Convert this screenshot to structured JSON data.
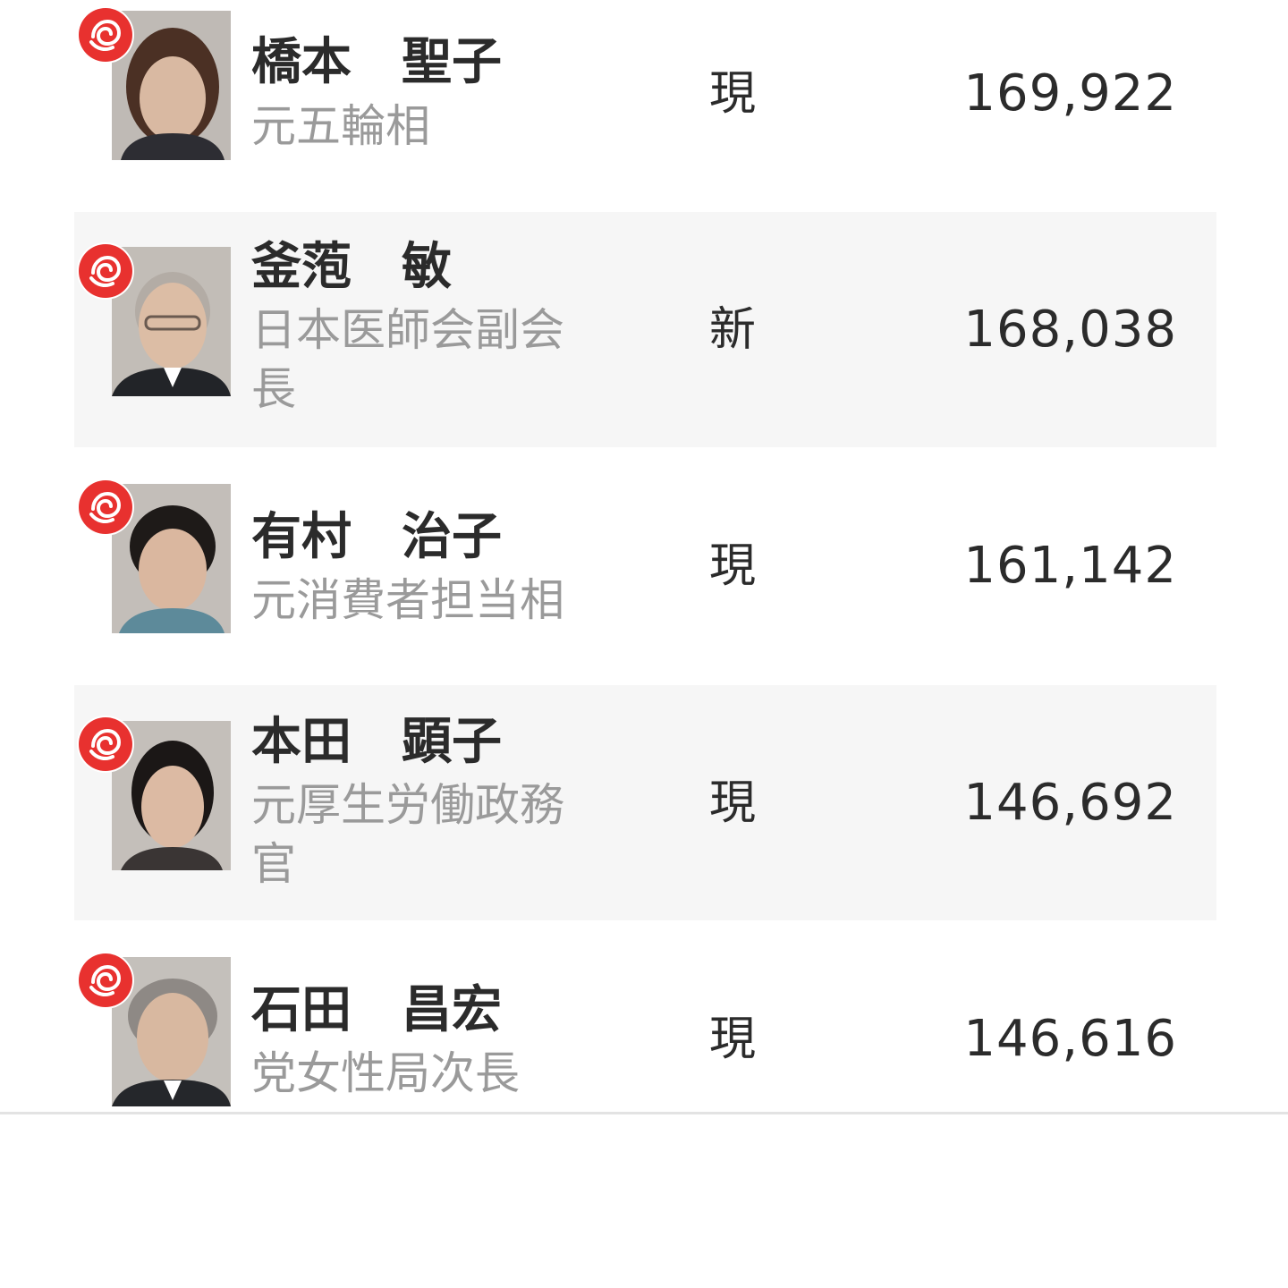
{
  "candidates": [
    {
      "name": "橋本　聖子",
      "title": "元五輪相",
      "status": "現",
      "votes": "169,922",
      "party_mark": "rose-icon",
      "party_color": "#e8312f"
    },
    {
      "name": "釜萢　敏",
      "title": "日本医師会副会長",
      "status": "新",
      "votes": "168,038",
      "party_mark": "rose-icon",
      "party_color": "#e8312f"
    },
    {
      "name": "有村　治子",
      "title": "元消費者担当相",
      "status": "現",
      "votes": "161,142",
      "party_mark": "rose-icon",
      "party_color": "#e8312f"
    },
    {
      "name": "本田　顕子",
      "title": "元厚生労働政務官",
      "status": "現",
      "votes": "146,692",
      "party_mark": "rose-icon",
      "party_color": "#e8312f"
    },
    {
      "name": "石田　昌宏",
      "title": "党女性局次長",
      "status": "現",
      "votes": "146,616",
      "party_mark": "rose-icon",
      "party_color": "#e8312f"
    }
  ]
}
